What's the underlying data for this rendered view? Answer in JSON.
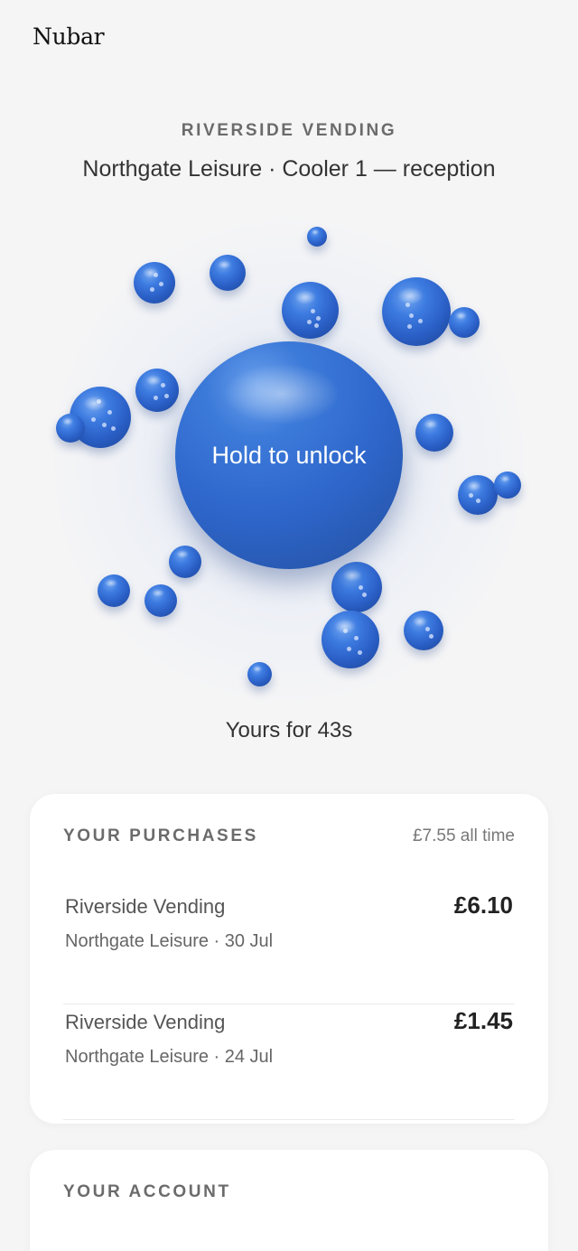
{
  "app": {
    "brand": "Nubar"
  },
  "machine": {
    "operator": "RIVERSIDE VENDING",
    "location": "Northgate Leisure · Cooler 1 — reception"
  },
  "unlock": {
    "label": "Hold to unlock",
    "timer": "Yours for 43s"
  },
  "purchases": {
    "title": "YOUR PURCHASES",
    "total": "£7.55 all time",
    "items": [
      {
        "vendor": "Riverside Vending",
        "detail": "Northgate Leisure · 30 Jul",
        "amount": "£6.10"
      },
      {
        "vendor": "Riverside Vending",
        "detail": "Northgate Leisure · 24 Jul",
        "amount": "£1.45"
      }
    ]
  },
  "account": {
    "title": "YOUR ACCOUNT"
  },
  "colors": {
    "accent": "#2e66cb",
    "background": "#f5f5f6",
    "card": "#ffffff"
  }
}
